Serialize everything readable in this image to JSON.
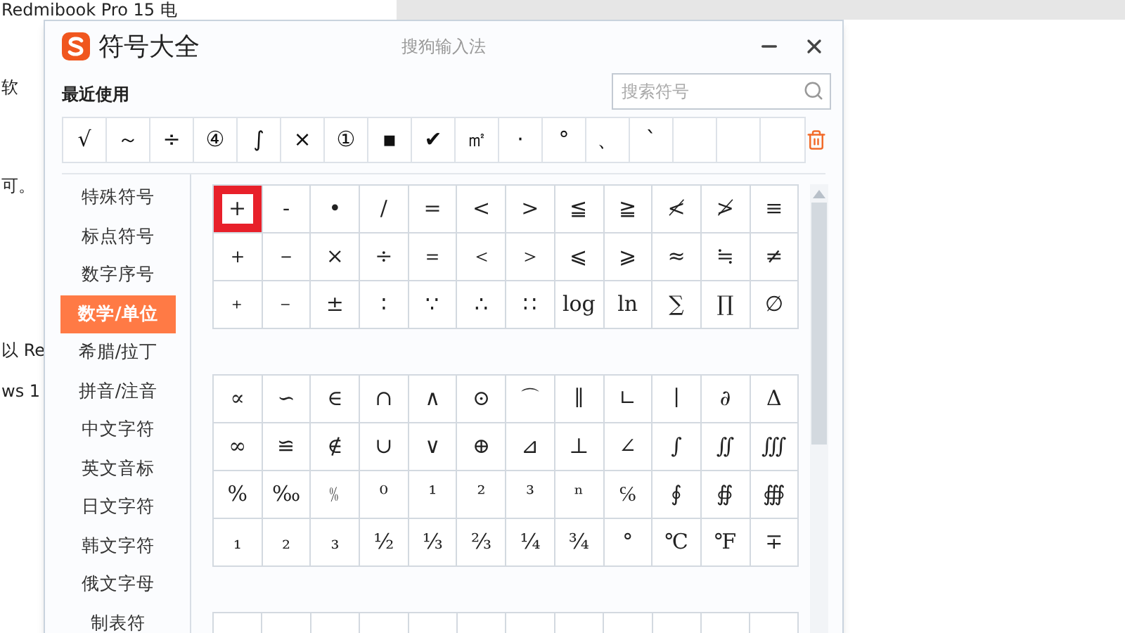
{
  "document": {
    "lines": [
      {
        "text": "Redmibook Pro 15 电"
      },
      {
        "text": "软"
      },
      {
        "text": "可。"
      },
      {
        "text": "以 Re"
      },
      {
        "text": "ws 1"
      }
    ]
  },
  "window": {
    "title": "符号大全",
    "app": "搜狗输入法"
  },
  "recent": {
    "label": "最近使用",
    "symbols": [
      "√",
      "～",
      "÷",
      "④",
      "∫",
      "×",
      "①",
      "▪",
      "✔",
      "㎡",
      "·",
      "°",
      "、",
      "ˋ"
    ]
  },
  "search": {
    "placeholder": "搜索符号"
  },
  "sidebar": {
    "items": [
      {
        "label": "特殊符号",
        "selected": false
      },
      {
        "label": "标点符号",
        "selected": false
      },
      {
        "label": "数字序号",
        "selected": false
      },
      {
        "label": "数学/单位",
        "selected": true
      },
      {
        "label": "希腊/拉丁",
        "selected": false
      },
      {
        "label": "拼音/注音",
        "selected": false
      },
      {
        "label": "中文字符",
        "selected": false
      },
      {
        "label": "英文音标",
        "selected": false
      },
      {
        "label": "日文字符",
        "selected": false
      },
      {
        "label": "韩文字符",
        "selected": false
      },
      {
        "label": "俄文字母",
        "selected": false
      },
      {
        "label": "制表符",
        "selected": false
      }
    ]
  },
  "sections": [
    {
      "symbols": [
        {
          "symbol": "+",
          "selected": true
        },
        {
          "symbol": "-",
          "selected": false
        },
        {
          "symbol": "•",
          "selected": false
        },
        {
          "symbol": "/",
          "selected": false
        },
        {
          "symbol": "=",
          "selected": false
        },
        {
          "symbol": "<",
          "selected": false
        },
        {
          "symbol": ">",
          "selected": false
        },
        {
          "symbol": "≦",
          "selected": false
        },
        {
          "symbol": "≧",
          "selected": false
        },
        {
          "symbol": "≮",
          "selected": false
        },
        {
          "symbol": "≯",
          "selected": false
        },
        {
          "symbol": "≡",
          "selected": false
        },
        {
          "symbol": "＋",
          "selected": false
        },
        {
          "symbol": "－",
          "selected": false
        },
        {
          "symbol": "×",
          "selected": false
        },
        {
          "symbol": "÷",
          "selected": false
        },
        {
          "symbol": "＝",
          "selected": false
        },
        {
          "symbol": "＜",
          "selected": false
        },
        {
          "symbol": "＞",
          "selected": false
        },
        {
          "symbol": "⩽",
          "selected": false
        },
        {
          "symbol": "⩾",
          "selected": false
        },
        {
          "symbol": "≈",
          "selected": false
        },
        {
          "symbol": "≒",
          "selected": false
        },
        {
          "symbol": "≠",
          "selected": false
        },
        {
          "symbol": "﹢",
          "selected": false
        },
        {
          "symbol": "﹣",
          "selected": false
        },
        {
          "symbol": "±",
          "selected": false
        },
        {
          "symbol": "∶",
          "selected": false
        },
        {
          "symbol": "∵",
          "selected": false
        },
        {
          "symbol": "∴",
          "selected": false
        },
        {
          "symbol": "∷",
          "selected": false
        },
        {
          "symbol": "log",
          "selected": false
        },
        {
          "symbol": "ln",
          "selected": false
        },
        {
          "symbol": "∑",
          "selected": false
        },
        {
          "symbol": "∏",
          "selected": false
        },
        {
          "symbol": "∅",
          "selected": false
        }
      ]
    },
    {
      "symbols": [
        {
          "symbol": "∝",
          "selected": false
        },
        {
          "symbol": "∽",
          "selected": false
        },
        {
          "symbol": "∈",
          "selected": false
        },
        {
          "symbol": "∩",
          "selected": false
        },
        {
          "symbol": "∧",
          "selected": false
        },
        {
          "symbol": "⊙",
          "selected": false
        },
        {
          "symbol": "⌒",
          "selected": false
        },
        {
          "symbol": "∥",
          "selected": false
        },
        {
          "symbol": "∟",
          "selected": false
        },
        {
          "symbol": "∣",
          "selected": false
        },
        {
          "symbol": "∂",
          "selected": false
        },
        {
          "symbol": "Δ",
          "selected": false
        },
        {
          "symbol": "∞",
          "selected": false
        },
        {
          "symbol": "≌",
          "selected": false
        },
        {
          "symbol": "∉",
          "selected": false
        },
        {
          "symbol": "∪",
          "selected": false
        },
        {
          "symbol": "∨",
          "selected": false
        },
        {
          "symbol": "⊕",
          "selected": false
        },
        {
          "symbol": "⊿",
          "selected": false
        },
        {
          "symbol": "⊥",
          "selected": false
        },
        {
          "symbol": "∠",
          "selected": false
        },
        {
          "symbol": "∫",
          "selected": false
        },
        {
          "symbol": "∬",
          "selected": false
        },
        {
          "symbol": "∭",
          "selected": false
        },
        {
          "symbol": "%",
          "selected": false
        },
        {
          "symbol": "‰",
          "selected": false
        },
        {
          "symbol": "﹪",
          "selected": false
        },
        {
          "symbol": "⁰",
          "selected": false
        },
        {
          "symbol": "¹",
          "selected": false
        },
        {
          "symbol": "²",
          "selected": false
        },
        {
          "symbol": "³",
          "selected": false
        },
        {
          "symbol": "ⁿ",
          "selected": false
        },
        {
          "symbol": "℅",
          "selected": false
        },
        {
          "symbol": "∮",
          "selected": false
        },
        {
          "symbol": "∯",
          "selected": false
        },
        {
          "symbol": "∰",
          "selected": false
        },
        {
          "symbol": "₁",
          "selected": false
        },
        {
          "symbol": "₂",
          "selected": false
        },
        {
          "symbol": "₃",
          "selected": false
        },
        {
          "symbol": "½",
          "selected": false
        },
        {
          "symbol": "⅓",
          "selected": false
        },
        {
          "symbol": "⅔",
          "selected": false
        },
        {
          "symbol": "¼",
          "selected": false
        },
        {
          "symbol": "¾",
          "selected": false
        },
        {
          "symbol": "°",
          "selected": false
        },
        {
          "symbol": "℃",
          "selected": false
        },
        {
          "symbol": "℉",
          "selected": false
        },
        {
          "symbol": "∓",
          "selected": false
        }
      ]
    }
  ]
}
